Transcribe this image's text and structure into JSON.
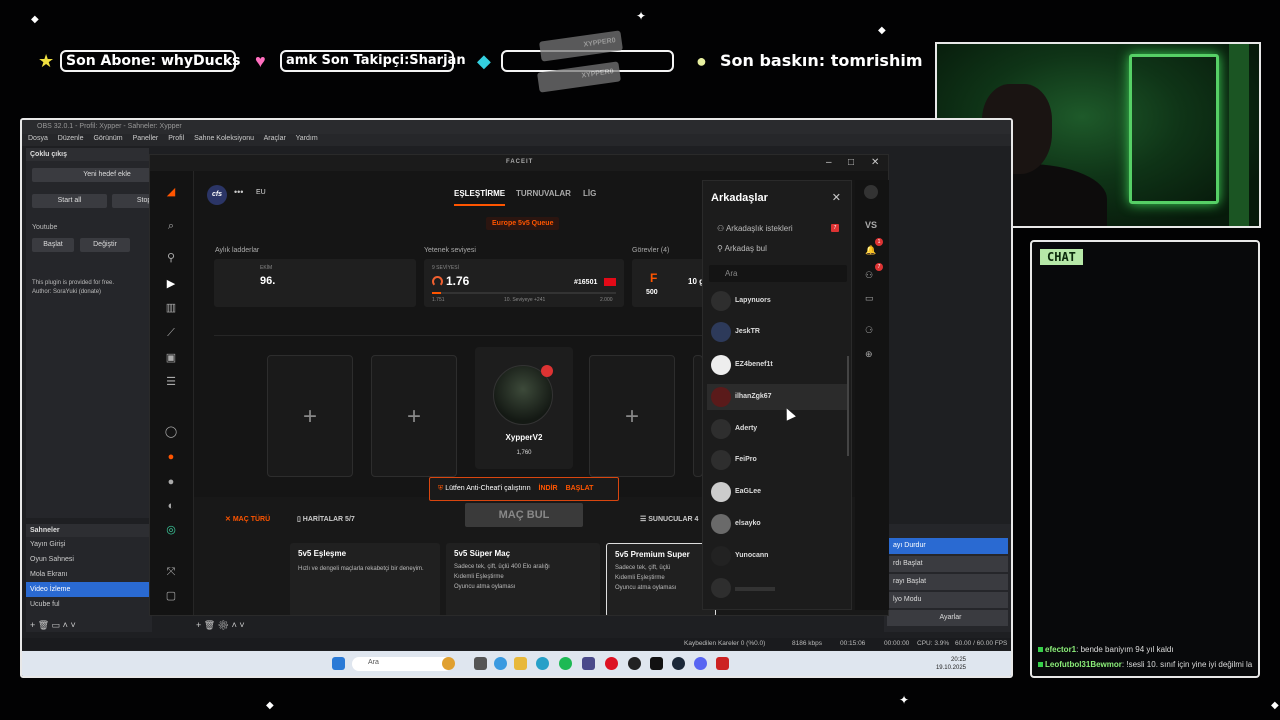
{
  "overlay": {
    "alerts": [
      {
        "label": "Son Abone: whyDucks",
        "icon": "star-icon",
        "color": "#f0e040"
      },
      {
        "label": "amk    Son Takipçi:Sharjan",
        "icon": "heart-icon",
        "color": "#ff6fbf"
      },
      {
        "label": "",
        "icon": "diamond-icon",
        "color": "#34d0e0"
      },
      {
        "label": "Son baskın: tomrishim",
        "icon": "circle-icon",
        "color": "#e8f0a0"
      }
    ],
    "social_cards": [
      "XYPPER0",
      "XYPPER0"
    ]
  },
  "chat": {
    "tag": "CHAT",
    "messages": [
      {
        "user": "efector1",
        "text": ": bende baniyım 94 yıl kaldı"
      },
      {
        "user": "Leofutbol31Bewmor",
        "text": ": !sesli 10. sınıf için yine iyi değilmi la"
      }
    ]
  },
  "obs": {
    "title": "OBS 32.0.1 - Profil: Xypper - Sahneler: Xypper",
    "menu": [
      "Dosya",
      "Düzenle",
      "Görünüm",
      "Paneller",
      "Profil",
      "Sahne Koleksiyonu",
      "Araçlar",
      "Yardım"
    ],
    "multi_output": {
      "title": "Çoklu çıkış",
      "add_target": "Yeni hedef ekle",
      "start_all": "Start all",
      "stop_all": "Stop a",
      "youtube": "Youtube",
      "start": "Başlat",
      "edit": "Değiştir",
      "plugin_note": "This plugin is provided for free.",
      "author": "Author: SoraYuki (donate)"
    },
    "scenes": {
      "title": "Sahneler",
      "items": [
        "Yayın Girişi",
        "Oyun Sahnesi",
        "Mola Ekranı",
        "Video İzleme",
        "Ucube ful"
      ],
      "active_index": 3
    },
    "controls": [
      "ayı Durdur",
      "rdı Başlat",
      "rayı Başlat",
      "lyo Modu",
      "Ayarlar"
    ],
    "status": {
      "dropped": "Kaybedilen Kareler 0 (%0.0)",
      "bitrate": "8186 kbps",
      "rec": "00:15:06",
      "rec2": "00:00:00",
      "cpu": "CPU: 3.9%",
      "fps": "60.00 / 60.00 FPS"
    }
  },
  "taskbar": {
    "search": "Ara",
    "time": "20:25",
    "date": "19.10.2025"
  },
  "faceit": {
    "brand": "FACEIT",
    "region": "EU",
    "team_tag": "cfs",
    "nav": [
      "EŞLEŞTİRME",
      "TURNUVALAR",
      "LİG"
    ],
    "queue": "Europe 5v5 Queue",
    "labels": {
      "ladders": "Aylık ladderlar",
      "skill": "Yetenek seviyesi",
      "tasks": "Görevler (4)"
    },
    "ladder": {
      "month": "EKİM",
      "rank": "96."
    },
    "skill": {
      "level_label": "9 SEVİYESİ",
      "elo": "1.76",
      "rank": "#16501",
      "min": "1.751",
      "next": "10. Seviyeye +241",
      "max": "2.000"
    },
    "tasks": {
      "letter": "F",
      "points": "500",
      "progress": "10 ga"
    },
    "player": {
      "name": "XypperV2",
      "elo": "1,760"
    },
    "warning": {
      "text": "Lütfen Anti-Cheat'i çalıştırın",
      "download": "İNDİR",
      "start": "BAŞLAT"
    },
    "tabs": [
      "MAÇ TÜRÜ",
      "HARİTALAR 5/7",
      "SUNUCULAR 4"
    ],
    "find_match": "MAÇ BUL",
    "modes": [
      {
        "title": "5v5 Eşleşme",
        "desc": "Hızlı ve dengeli maçlarla rekabetçi bir deneyim."
      },
      {
        "title": "5v5 Süper Maç",
        "l1": "Sadece tek, çift, üçlü",
        "l1b": "400 Elo aralığı",
        "l2": "Kıdemli Eşleştirme",
        "l3": "Oyuncu atma oylaması"
      },
      {
        "title": "5v5 Premium Super",
        "l1": "Sadece tek, çift, üçlü",
        "l2": "Kıdemli Eşleştirme",
        "l3": "Oyuncu atma oylaması"
      }
    ]
  },
  "friends": {
    "title": "Arkadaşlar",
    "requests": "Arkadaşlık istekleri",
    "requests_count": "7",
    "find": "Arkadaş bul",
    "search_placeholder": "Ara",
    "list": [
      "Lapynuors",
      "JeskTR",
      "EZ4benef1t",
      "ilhanZgk67",
      "Aderty",
      "FeiPro",
      "EaGLee",
      "elsayko",
      "Yunocann"
    ],
    "highlighted_index": 3,
    "vs": "VS",
    "notif_count": "1",
    "friend_count": "7"
  }
}
